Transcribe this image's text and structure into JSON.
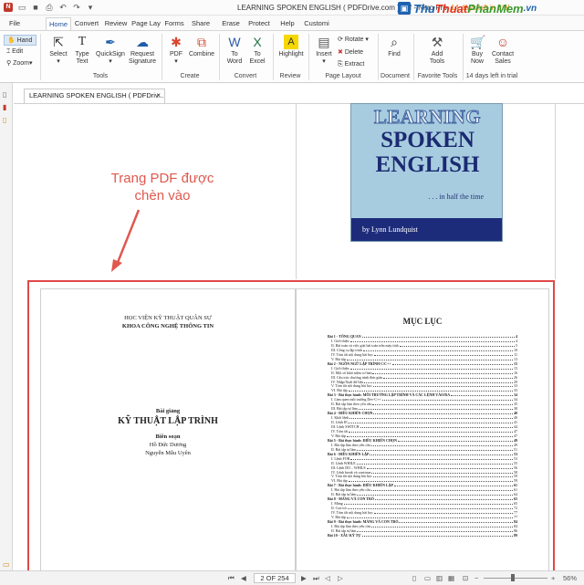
{
  "titlebar": {
    "title": "LEARNING SPOKEN ENGLISH ( PDFDrive.com ).pdf - Nitro Pro",
    "trial": "14 days left in trial",
    "brand": {
      "part1": "Thu",
      "part2": "Thuat",
      "part3": "PhanMem",
      "part4": ".vn"
    }
  },
  "tabs": [
    "File",
    "Home",
    "Convert",
    "Review",
    "Page Lay",
    "Forms",
    "Share",
    "Erase",
    "Protect",
    "Help",
    "Customi"
  ],
  "modes": {
    "hand": "Hand",
    "edit": "Edit",
    "zoom": "Zoom"
  },
  "ribbon": {
    "select": "Select",
    "type_text": [
      "Type",
      "Text"
    ],
    "quicksign": [
      "QuickSign"
    ],
    "request_signature": [
      "Request",
      "Signature"
    ],
    "pdf": "PDF",
    "combine": "Combine",
    "to_word": [
      "To",
      "Word"
    ],
    "to_excel": [
      "To",
      "Excel"
    ],
    "highlight": "Highlight",
    "insert": "Insert",
    "rotate": "Rotate",
    "delete": "Delete",
    "extract": "Extract",
    "find": "Find",
    "add_tools": [
      "Add",
      "Tools"
    ],
    "buy_now": [
      "Buy",
      "Now"
    ],
    "contact_sales": [
      "Contact",
      "Sales"
    ],
    "groups": {
      "tools": "Tools",
      "create": "Create",
      "convert": "Convert",
      "review": "Review",
      "page_layout": "Page Layout",
      "document": "Document",
      "favorite_tools": "Favorite Tools",
      "trial": "14 days left in trial"
    }
  },
  "document_tab": {
    "label": "LEARNING SPOKEN ENGLISH ( PDFDriv...",
    "close": "×"
  },
  "cover": {
    "line1": "LEARNING",
    "line2": "SPOKEN",
    "line3": "ENGLISH",
    "tagline": ". . . in half the time",
    "author": "by Lynn Lundquist"
  },
  "annotation": {
    "line1": "Trang PDF được",
    "line2": "chèn vào"
  },
  "left_page": {
    "institute": "HỌC VIỆN KỸ THUẬT QUÂN SỰ",
    "faculty": "KHOA CÔNG NGHỆ THÔNG TIN",
    "lecture": "Bài giảng",
    "subject": "KỸ THUẬT LẬP TRÌNH",
    "compiled": "Biên soạn",
    "author1": "Hồ Đức Dương",
    "author2": "Nguyễn Mẫu Uyên"
  },
  "toc": {
    "title": "MỤC LỤC",
    "entries": [
      {
        "text": "Bài 1 - TỔNG QUAN",
        "page": "4",
        "head": true
      },
      {
        "text": "I. Giới thiệu",
        "page": "4"
      },
      {
        "text": "II. Bài toán và việc giải bài toán trên máy tính",
        "page": "5"
      },
      {
        "text": "III. Công cụ lập trình",
        "page": "10"
      },
      {
        "text": "IV. Tóm tắt nội dung bài học",
        "page": "11"
      },
      {
        "text": "V. Bài tập",
        "page": "13"
      },
      {
        "text": "Bài 2 - NGÔN NGỮ LẬP TRÌNH C/C++",
        "page": "15",
        "head": true
      },
      {
        "text": "I. Giới thiệu",
        "page": "15"
      },
      {
        "text": "II. Một số khái niệm cơ bản",
        "page": "16"
      },
      {
        "text": "III. Cấu trúc chương trình đơn giản",
        "page": "26"
      },
      {
        "text": "IV. Nhập/Xuất dữ liệu",
        "page": "29"
      },
      {
        "text": "V. Tóm tắt nội dung bài học",
        "page": "33"
      },
      {
        "text": "VI. Bài tập",
        "page": "33"
      },
      {
        "text": "Bài 3 - Bài thực hành: MÔI TRƯỜNG LẬP TRÌNH VÀ CÁC LỆNH VÀO/RA",
        "page": "34",
        "head": true
      },
      {
        "text": "I. Làm quen môi trường Dev-C++",
        "page": "34"
      },
      {
        "text": "II. Bài tập làm theo yêu cầu",
        "page": "35"
      },
      {
        "text": "III. Bài tập tự làm",
        "page": "38"
      },
      {
        "text": "Bài 4 - ĐIỀU KHIỂN CHỌN",
        "page": "40",
        "head": true
      },
      {
        "text": "I. Khối lệnh",
        "page": "40"
      },
      {
        "text": "II. Lệnh IF",
        "page": "41"
      },
      {
        "text": "III. Lệnh SWITCH",
        "page": "44"
      },
      {
        "text": "IV. Tóm tắt",
        "page": "47"
      },
      {
        "text": "V. Bài tập",
        "page": "47"
      },
      {
        "text": "Bài 5 - Bài thực hành: ĐIỀU KHIỂN CHỌN",
        "page": "49",
        "head": true
      },
      {
        "text": "I. Bài tập làm theo yêu cầu",
        "page": "49"
      },
      {
        "text": "II. Bài tập tự làm",
        "page": "51"
      },
      {
        "text": "Bài 6 - ĐIỀU KHIỂN LẶP",
        "page": "53",
        "head": true
      },
      {
        "text": "I. Lệnh FOR",
        "page": "53"
      },
      {
        "text": "II. Lệnh WHILE",
        "page": "55"
      },
      {
        "text": "III. Lệnh DO .. WHILE",
        "page": "56"
      },
      {
        "text": "IV. Lệnh break và continue",
        "page": "58"
      },
      {
        "text": "V. Tóm tắt nội dung bài học",
        "page": "59"
      },
      {
        "text": "VI. Bài tập",
        "page": "59"
      },
      {
        "text": "Bài 7 - Bài thực hành: ĐIỀU KHIỂN LẶP",
        "page": "61",
        "head": true
      },
      {
        "text": "I. Bài tập làm theo yêu cầu",
        "page": "61"
      },
      {
        "text": "II. Bài tập tự làm",
        "page": "64"
      },
      {
        "text": "Bài 8 - MẢNG VÀ CON TRỎ",
        "page": "65",
        "head": true
      },
      {
        "text": "I. Mảng",
        "page": "65"
      },
      {
        "text": "II. Con trỏ",
        "page": "72"
      },
      {
        "text": "IV. Tóm tắt nội dung bài học",
        "page": "77"
      },
      {
        "text": "V. Bài tập",
        "page": "77"
      },
      {
        "text": "Bài 9 - Bài thực hành: MẢNG VÀ CON TRỎ",
        "page": "84",
        "head": true
      },
      {
        "text": "I. Bài tập làm theo yêu cầu",
        "page": "84"
      },
      {
        "text": "II. Bài tập tự làm",
        "page": "86"
      },
      {
        "text": "Bài 10 - XÂU KÝ TỰ",
        "page": "89",
        "head": true
      }
    ]
  },
  "statusbar": {
    "page": "2 OF 254",
    "zoom": "56%"
  },
  "colors": {
    "accent": "#1b4f9c",
    "annotation": "#e0584f",
    "frame": "#e04848",
    "cover_bg": "#a7ccdf",
    "cover_text": "#1b2a72"
  }
}
